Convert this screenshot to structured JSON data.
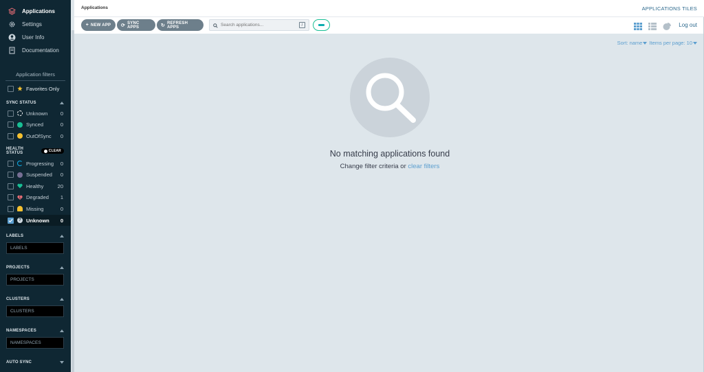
{
  "nav": [
    {
      "label": "Applications",
      "icon": "stack-icon",
      "active": true
    },
    {
      "label": "Settings",
      "icon": "gear-icon",
      "active": false
    },
    {
      "label": "User Info",
      "icon": "user-icon",
      "active": false
    },
    {
      "label": "Documentation",
      "icon": "book-icon",
      "active": false
    }
  ],
  "filters": {
    "title": "Application filters",
    "favorites_label": "Favorites Only",
    "sync_status": {
      "title": "SYNC STATUS",
      "items": [
        {
          "label": "Unknown",
          "count": "0",
          "color": "#ffffff"
        },
        {
          "label": "Synced",
          "count": "0",
          "color": "#18be94"
        },
        {
          "label": "OutOfSync",
          "count": "0",
          "color": "#f4c030"
        }
      ]
    },
    "health_status": {
      "title": "HEALTH STATUS",
      "clear_label": "CLEAR",
      "items": [
        {
          "label": "Progressing",
          "count": "0",
          "color": "#0dadea",
          "checked": false
        },
        {
          "label": "Suspended",
          "count": "0",
          "color": "#766f94",
          "checked": false
        },
        {
          "label": "Healthy",
          "count": "20",
          "color": "#18be94",
          "checked": false
        },
        {
          "label": "Degraded",
          "count": "1",
          "color": "#e96d76",
          "checked": false
        },
        {
          "label": "Missing",
          "count": "0",
          "color": "#f4c030",
          "checked": false
        },
        {
          "label": "Unknown",
          "count": "0",
          "color": "#ccd6dd",
          "checked": true
        }
      ]
    },
    "labels": {
      "title": "LABELS",
      "placeholder": "LABELS"
    },
    "projects": {
      "title": "PROJECTS",
      "placeholder": "PROJECTS"
    },
    "clusters": {
      "title": "CLUSTERS",
      "placeholder": "CLUSTERS"
    },
    "namespaces": {
      "title": "NAMESPACES",
      "placeholder": "NAMESPACES"
    },
    "auto_sync": {
      "title": "AUTO SYNC"
    }
  },
  "header": {
    "title": "Applications",
    "view_label": "APPLICATIONS TILES",
    "logout_label": "Log out"
  },
  "toolbar": {
    "new_app": "NEW APP",
    "sync_apps": "SYNC APPS",
    "refresh_apps": "REFRESH APPS",
    "search_placeholder": "Search applications...",
    "search_shortcut": "/"
  },
  "sort": {
    "sort_label": "Sort: name",
    "per_page_label": "Items per page: 10"
  },
  "empty": {
    "title": "No matching applications found",
    "subtitle": "Change filter criteria or",
    "link": "clear filters"
  },
  "colors": {
    "sidebar_bg": "#0f2733",
    "accent": "#5b9ecf",
    "button_gray": "#6d7f8b",
    "teal": "#18be94"
  }
}
